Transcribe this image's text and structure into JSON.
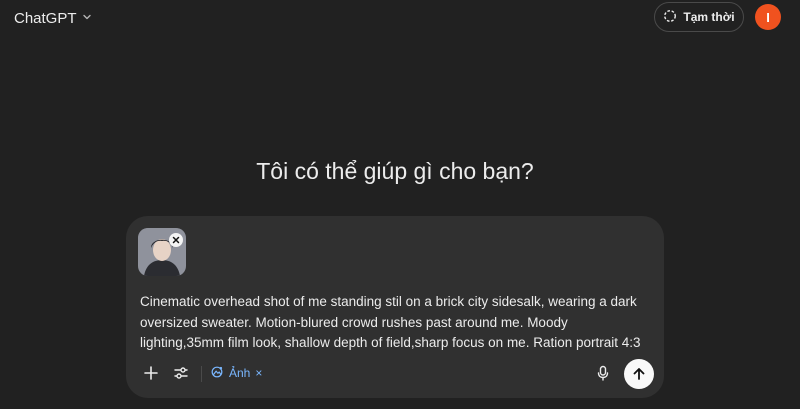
{
  "header": {
    "model_name": "ChatGPT",
    "temporary_label": "Tạm thời",
    "avatar_initial": "I"
  },
  "main": {
    "heading": "Tôi có thể giúp gì cho bạn?"
  },
  "composer": {
    "prompt": "Cinematic overhead shot of me standing stil on a brick city sidesalk, wearing a dark oversized sweater. Motion-blured crowd rushes past around me. Moody lighting,35mm film look, shallow depth of field,sharp focus on me. Ration portrait 4:3",
    "tool_chip_label": "Ảnh",
    "tool_chip_close": "×"
  },
  "colors": {
    "background": "#212121",
    "composer": "#303030",
    "avatar": "#f0521f",
    "chip_accent": "#7ab7ff"
  },
  "icons": [
    "chevron-down-icon",
    "dashed-circle-icon",
    "close-icon",
    "plus-icon",
    "sliders-icon",
    "image-gen-icon",
    "microphone-icon",
    "arrow-up-icon"
  ]
}
